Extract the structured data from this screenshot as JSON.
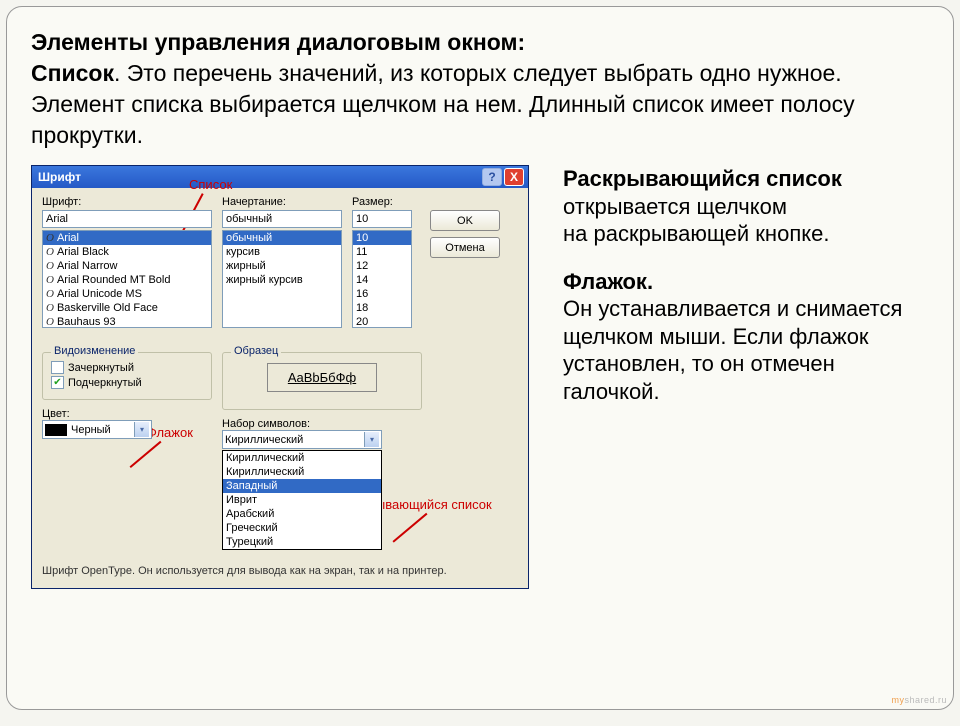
{
  "heading": {
    "l1": "Элементы управления диалоговым окном:",
    "l2a": "Список",
    "l2b": ". Это перечень значений, из которых следует выбрать одно нужное. Элемент списка выбирается щелчком на нем. Длинный список имеет полосу прокрутки."
  },
  "dialog": {
    "title": "Шрифт",
    "help": "?",
    "close": "X",
    "font_label": "Шрифт:",
    "font_value": "Arial",
    "font_list": [
      "Arial",
      "Arial Black",
      "Arial Narrow",
      "Arial Rounded MT Bold",
      "Arial Unicode MS",
      "Baskerville Old Face",
      "Bauhaus 93"
    ],
    "style_label": "Начертание:",
    "style_value": "обычный",
    "style_list": [
      "обычный",
      "курсив",
      "жирный",
      "жирный курсив"
    ],
    "size_label": "Размер:",
    "size_value": "10",
    "size_list": [
      "10",
      "11",
      "12",
      "14",
      "16",
      "18",
      "20"
    ],
    "ok": "OK",
    "cancel": "Отмена",
    "effects_title": "Видоизменение",
    "strike": "Зачеркнутый",
    "underline": "Подчеркнутый",
    "sample_title": "Образец",
    "sample_text": "AaBbБбФф",
    "color_label": "Цвет:",
    "color_value": "Черный",
    "charset_label": "Набор символов:",
    "charset_value": "Кириллический",
    "charset_list": [
      "Кириллический",
      "Кириллический",
      "Западный",
      "Иврит",
      "Арабский",
      "Греческий",
      "Турецкий"
    ],
    "status": "Шрифт OpenType. Он используется для вывода как на экран, так и на принтер."
  },
  "annotations": {
    "list": "Список",
    "checkbox": "Флажок",
    "dropdown": "Раскрывающийся список"
  },
  "side": {
    "p1b": "Раскрывающийся список",
    "p1": " открывается щелчком",
    "p1c": " на раскрывающей кнопке.",
    "p2b": "Флажок.",
    "p2": "Он устанавливается и снимается щелчком мыши. Если флажок установлен, то он отмечен галочкой."
  },
  "watermark_a": "my",
  "watermark_b": "shared",
  "watermark_c": ".ru"
}
